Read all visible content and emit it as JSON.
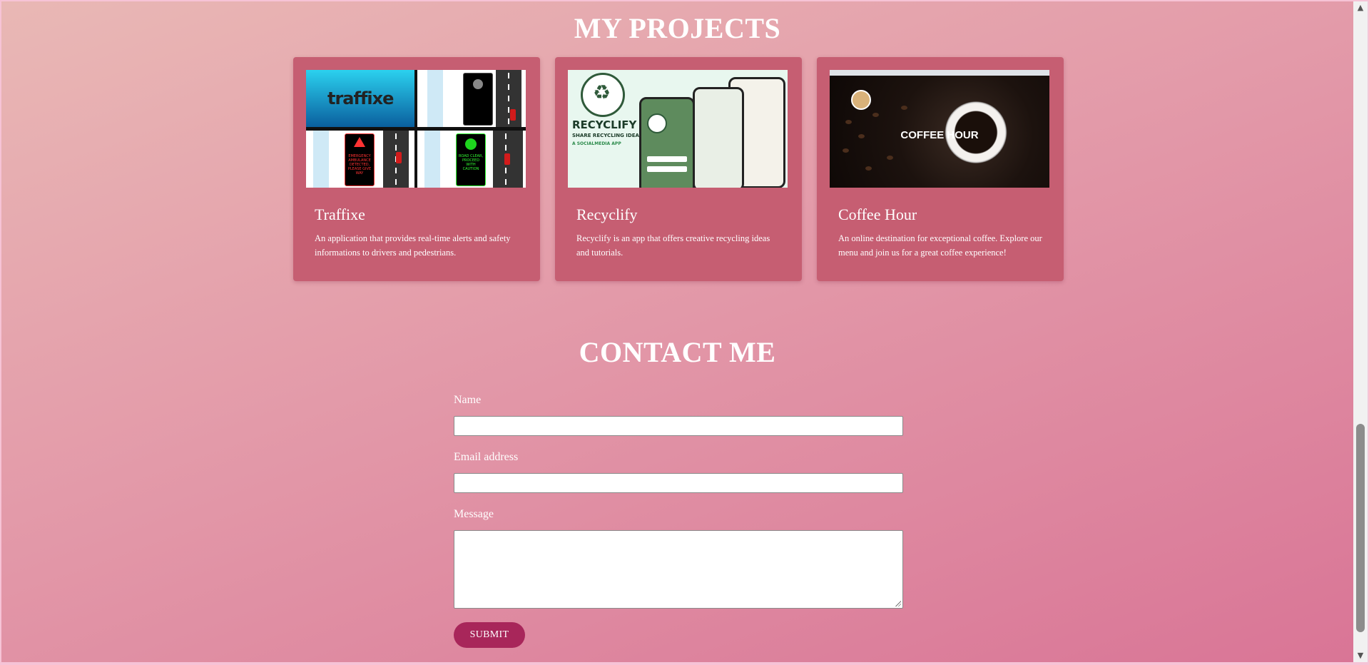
{
  "projects": {
    "title": "MY PROJECTS",
    "cards": [
      {
        "title": "Traffixe",
        "description": "An application that provides real-time alerts and safety informations to drivers and pedestrians.",
        "thumb_logo": "traffixe",
        "thumb_alert": "EMERGENCY AMBULANCE DETECTED, PLEASE GIVE WAY",
        "thumb_clear": "ROAD CLEAR, PROCEED WITH CAUTION"
      },
      {
        "title": "Recyclify",
        "description": "Recyclify is an app that offers creative recycling ideas and tutorials.",
        "thumb_brand": "RECYCLIFY",
        "thumb_tag": "SHARE RECYCLING IDEAS",
        "thumb_sub": "A SOCIALMEDIA APP"
      },
      {
        "title": "Coffee Hour",
        "description": "An online destination for exceptional coffee. Explore our menu and join us for a great coffee experience!",
        "thumb_overlay": "COFFEE HOUR"
      }
    ]
  },
  "contact": {
    "title": "CONTACT ME",
    "name_label": "Name",
    "name_value": "",
    "email_label": "Email address",
    "email_value": "",
    "message_label": "Message",
    "message_value": "",
    "submit_label": "SUBMIT"
  },
  "colors": {
    "card_bg": "#c65e72",
    "submit_bg": "#a8265a",
    "page_gradient_start": "#e9b8b5",
    "page_gradient_end": "#d97596"
  },
  "icons": {
    "scroll_up": "chevron-up-icon",
    "scroll_down": "chevron-down-icon"
  }
}
